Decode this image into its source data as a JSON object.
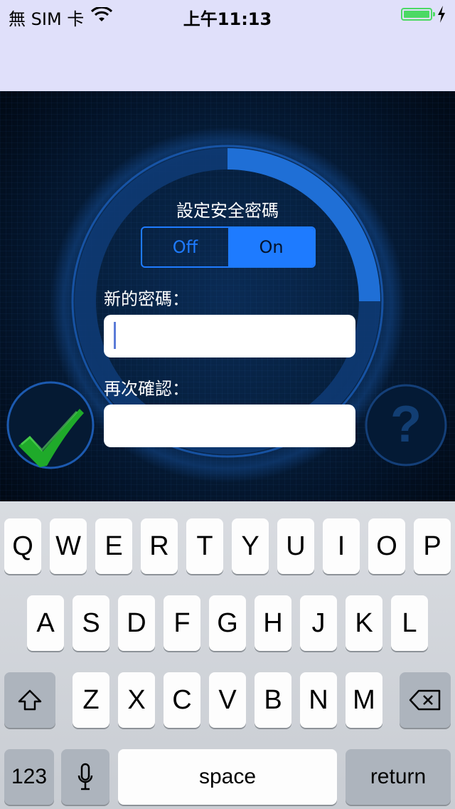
{
  "status_bar": {
    "carrier": "無 SIM 卡",
    "time": "上午11:13",
    "battery_level": 1.0
  },
  "colors": {
    "accent": "#1e7bff",
    "check": "#1faa2a",
    "nav_bg": "#e0e0fa"
  },
  "form": {
    "title": "設定安全密碼",
    "toggle": {
      "off_label": "Off",
      "on_label": "On",
      "selected": "On"
    },
    "new_password_label": "新的密碼：",
    "confirm_label": "再次確認：",
    "new_password_value": "",
    "confirm_value": ""
  },
  "buttons": {
    "confirm_icon": "checkmark-icon",
    "help_icon": "question-icon",
    "help_glyph": "?"
  },
  "keyboard": {
    "row1": [
      "Q",
      "W",
      "E",
      "R",
      "T",
      "Y",
      "U",
      "I",
      "O",
      "P"
    ],
    "row2": [
      "A",
      "S",
      "D",
      "F",
      "G",
      "H",
      "J",
      "K",
      "L"
    ],
    "row3": [
      "Z",
      "X",
      "C",
      "V",
      "B",
      "N",
      "M"
    ],
    "numbers_label": "123",
    "space_label": "space",
    "return_label": "return",
    "shift_icon": "shift-icon",
    "delete_icon": "delete-icon",
    "mic_icon": "microphone-icon"
  }
}
